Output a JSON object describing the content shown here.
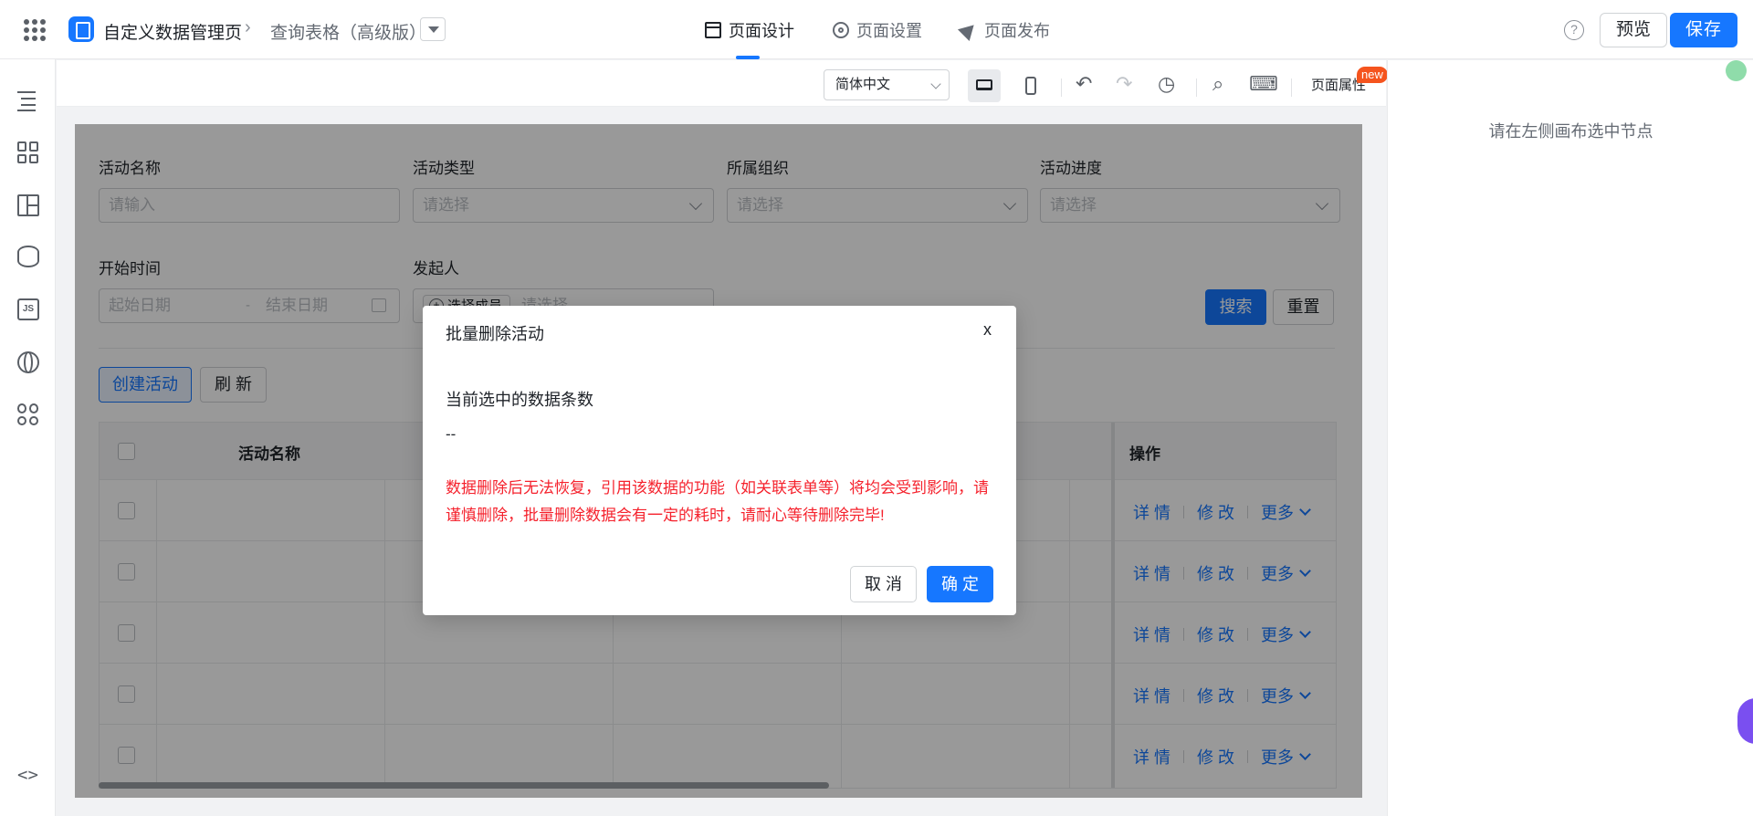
{
  "header": {
    "app_name": "自定义数据管理页",
    "breadcrumb_sep": "›",
    "page_name": "查询表格（高级版）",
    "tabs": [
      {
        "label": "页面设计",
        "icon": "layout-icon",
        "active": true
      },
      {
        "label": "页面设置",
        "icon": "gear-icon",
        "active": false
      },
      {
        "label": "页面发布",
        "icon": "send-icon",
        "active": false
      }
    ],
    "help_glyph": "?",
    "preview_label": "预览",
    "save_label": "保存"
  },
  "sidebar": {
    "icons": [
      "outline-tree-icon",
      "components-grid-icon",
      "layout-panel-icon",
      "data-source-icon",
      "js-code-icon",
      "globe-icon",
      "plugins-icon"
    ],
    "bottom_icon": "code-toggle-icon",
    "bottom_glyph": "<>"
  },
  "canvas_toolbar": {
    "language": "简体中文",
    "undo_glyph": "↶",
    "redo_glyph": "↷",
    "history_glyph": "◷",
    "search_glyph": "⌕",
    "keyboard_glyph": "⌨",
    "page_attr_label": "页面属性",
    "new_badge": "new"
  },
  "right_panel": {
    "hint": "请在左侧画布选中节点"
  },
  "form": {
    "fields": [
      {
        "label": "活动名称",
        "placeholder": "请输入"
      },
      {
        "label": "活动类型",
        "placeholder": "请选择"
      },
      {
        "label": "所属组织",
        "placeholder": "请选择"
      },
      {
        "label": "活动进度",
        "placeholder": "请选择"
      }
    ],
    "start_time": {
      "label": "开始时间",
      "start_placeholder": "起始日期",
      "sep": "-",
      "end_placeholder": "结束日期"
    },
    "initiator": {
      "label": "发起人",
      "chip": "选择成员",
      "placeholder": "请选择"
    },
    "search_label": "搜索",
    "reset_label": "重置"
  },
  "actions": {
    "create_label": "创建活动",
    "refresh_label": "刷 新"
  },
  "table": {
    "columns": [
      "活动名称",
      "操作"
    ],
    "row_actions": {
      "detail": "详 情",
      "edit": "修 改",
      "more": "更多"
    }
  },
  "modal": {
    "title": "批量删除活动",
    "close": "x",
    "selected_label": "当前选中的数据条数",
    "selected_value": "--",
    "warning": "数据删除后无法恢复，引用该数据的功能（如关联表单等）将均会受到影响，请谨慎删除，批量删除数据会有一定的耗时，请耐心等待删除完毕!",
    "cancel_label": "取 消",
    "ok_label": "确 定"
  },
  "colors": {
    "primary": "#1677ff",
    "danger": "#f5222d",
    "new_badge": "#f5541e"
  }
}
